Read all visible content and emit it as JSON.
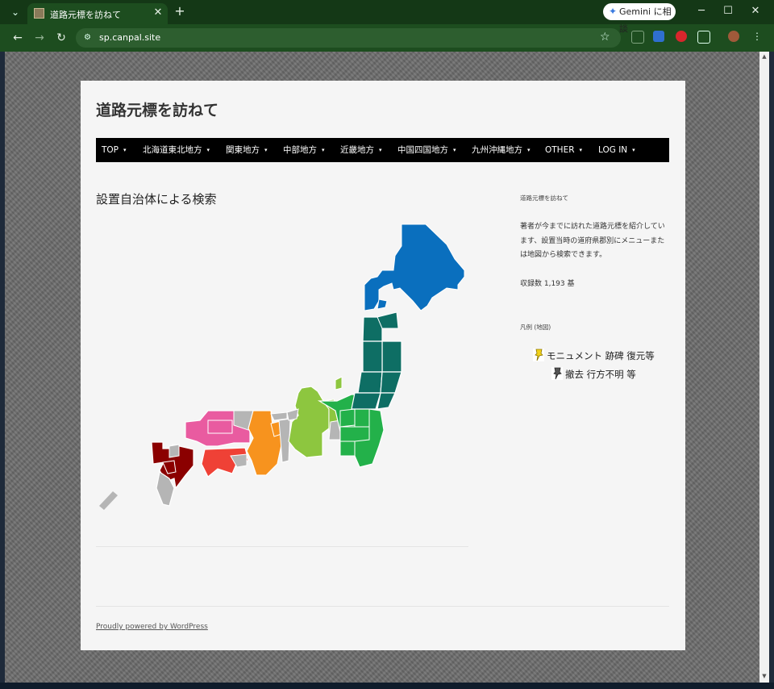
{
  "browser": {
    "tab_title": "道路元標を訪ねて",
    "tab_dropdown_icon": "chevron-down-icon",
    "new_tab": "+",
    "close": "✕",
    "gemini_label": "Gemini に相談",
    "url": "sp.canpal.site",
    "win_min": "─",
    "win_max": "☐",
    "win_close": "✕",
    "back": "←",
    "forward": "→",
    "reload": "↻",
    "bookmark": "☆"
  },
  "site": {
    "title": "道路元標を訪ねて",
    "menu": [
      {
        "label": "TOP"
      },
      {
        "label": "北海道東北地方"
      },
      {
        "label": "関東地方"
      },
      {
        "label": "中部地方"
      },
      {
        "label": "近畿地方"
      },
      {
        "label": "中国四国地方"
      },
      {
        "label": "九州沖縄地方"
      },
      {
        "label": "OTHER"
      },
      {
        "label": "LOG IN"
      }
    ],
    "caret": "▾"
  },
  "main": {
    "section_title": "設置自治体による検索",
    "map_colors": {
      "hokkaido": "#0a6fbe",
      "tohoku": "#0e6e64",
      "kanto": "#23b14a",
      "chubu_north": "#8dc63f",
      "kinki": "#f7931e",
      "chugoku": "#e95ba0",
      "shikoku": "#ef4136",
      "kyushu": "#8b0000",
      "inactive": "#b5b5b5"
    }
  },
  "sidebar": {
    "heading": "道路元標を訪ねて",
    "description": "著者が今までに訪れた道路元標を紹介しています、設置当時の道府県郡別にメニューまたは地図から検索できます。",
    "count": "収録数 1,193 基",
    "legend_heading": "凡例 (地図)",
    "legend": [
      {
        "label": "モニュメント 跡碑 復元等",
        "icon": "yellow-pin-icon",
        "color": "#f2d21a"
      },
      {
        "label": "撤去 行方不明 等",
        "icon": "gray-pin-icon",
        "color": "#555555"
      }
    ]
  },
  "footer": {
    "link": "Proudly powered by WordPress"
  }
}
